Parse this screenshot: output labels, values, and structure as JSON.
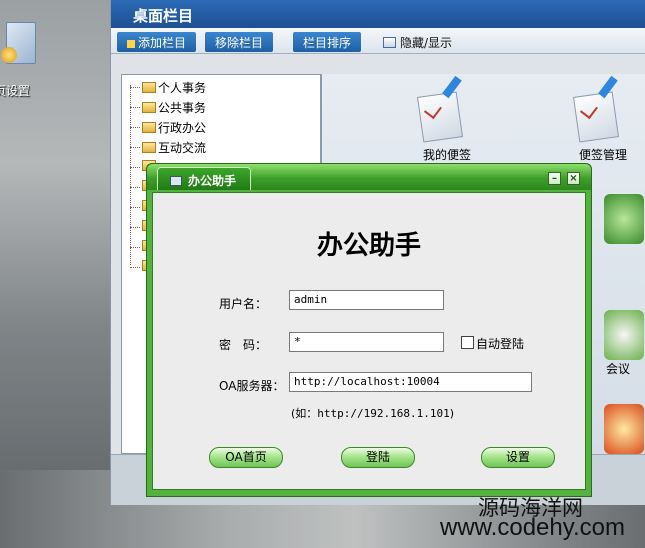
{
  "desktop": {
    "shortcut_label": "页设置"
  },
  "app": {
    "title": "桌面栏目",
    "toolbar": {
      "add_label": "添加栏目",
      "remove_label": "移除栏目",
      "sort_label": "栏目排序",
      "toggle_label": "隐藏/显示"
    },
    "tree": {
      "items": [
        "个人事务",
        "公共事务",
        "行政办公",
        "互动交流",
        "",
        "",
        "",
        "",
        "",
        ""
      ]
    },
    "tiles": {
      "my_notes_label": "我的便签",
      "notes_manage_label": "便签管理",
      "meeting_label": "会议"
    }
  },
  "dialog": {
    "title": "办公助手",
    "heading": "办公助手",
    "username": {
      "label": "用户名：",
      "value": "admin"
    },
    "password": {
      "label": "密　码：",
      "value": "*"
    },
    "auto_login_label": "自动登陆",
    "server": {
      "label": "OA服务器：",
      "value": "http://localhost:10004"
    },
    "hint_prefix": "(如：",
    "hint_example": "http://192.168.1.101",
    "hint_suffix": ")",
    "buttons": {
      "home_label": "OA首页",
      "login_label": "登陆",
      "settings_label": "设置"
    }
  },
  "watermark": {
    "line1": "源码海洋网",
    "line2": "www.codehy.com"
  },
  "colors": {
    "app_title_bg": "#1e4f92",
    "dialog_green": "#56b23f",
    "button_green": "#6ec556"
  }
}
